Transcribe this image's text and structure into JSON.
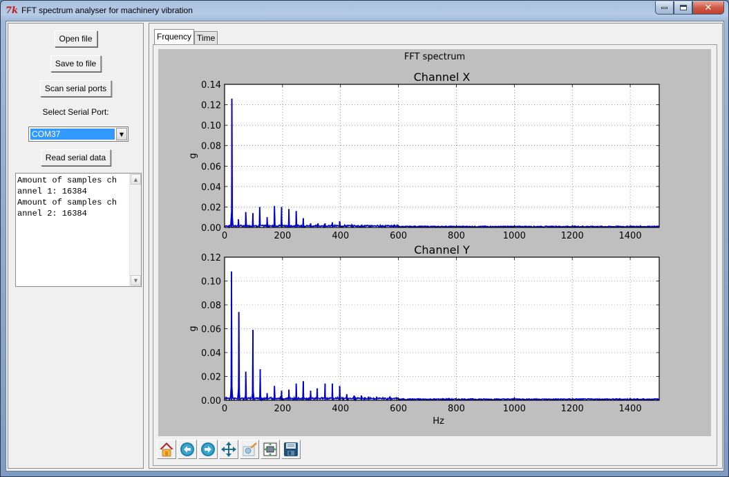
{
  "window": {
    "title": "FFT spectrum analyser for machinery vibration",
    "app_icon": "tk-feather-icon",
    "controls": {
      "minimize": "minimize",
      "maximize": "maximize",
      "close": "close"
    }
  },
  "left_panel": {
    "open_file": "Open file",
    "save_to_file": "Save to file",
    "scan_serial_ports": "Scan serial ports",
    "select_port_label": "Select Serial Port:",
    "serial_port_value": "COM37",
    "read_serial_data": "Read serial data",
    "log_text": "Amount of samples ch\nannel 1: 16384\nAmount of samples ch\nannel 2: 16384"
  },
  "tabs": [
    {
      "label": "Frquency",
      "active": true
    },
    {
      "label": "Time",
      "active": false
    }
  ],
  "toolbar": {
    "items": [
      {
        "name": "home",
        "icon": "home-icon"
      },
      {
        "name": "back",
        "icon": "back-arrow-icon"
      },
      {
        "name": "forward",
        "icon": "forward-arrow-icon"
      },
      {
        "name": "pan",
        "icon": "pan-move-icon"
      },
      {
        "name": "zoom",
        "icon": "zoom-rect-icon"
      },
      {
        "name": "subplots",
        "icon": "configure-subplots-icon"
      },
      {
        "name": "save",
        "icon": "save-floppy-icon"
      }
    ]
  },
  "chart_data": {
    "suptitle": "FFT spectrum",
    "colors": {
      "line": "#0000cc",
      "figure_bg": "#bfbfbf",
      "axes_bg": "#ffffff"
    },
    "charts": [
      {
        "type": "line",
        "title": "Channel X",
        "xlabel": "",
        "ylabel": "g",
        "xlim": [
          0,
          1500
        ],
        "ylim": [
          0,
          0.14
        ],
        "xticks": [
          0,
          200,
          400,
          600,
          800,
          1000,
          1200,
          1400
        ],
        "yticks": [
          "0.00",
          "0.02",
          "0.04",
          "0.06",
          "0.08",
          "0.10",
          "0.12",
          "0.14"
        ],
        "grid": true,
        "baseline": 0.001,
        "peaks": [
          {
            "x": 25,
            "y": 0.126
          },
          {
            "x": 48,
            "y": 0.008
          },
          {
            "x": 73,
            "y": 0.015
          },
          {
            "x": 98,
            "y": 0.014
          },
          {
            "x": 121,
            "y": 0.02
          },
          {
            "x": 147,
            "y": 0.01
          },
          {
            "x": 172,
            "y": 0.021
          },
          {
            "x": 197,
            "y": 0.02
          },
          {
            "x": 222,
            "y": 0.018
          },
          {
            "x": 247,
            "y": 0.016
          },
          {
            "x": 272,
            "y": 0.009
          },
          {
            "x": 297,
            "y": 0.004
          },
          {
            "x": 322,
            "y": 0.004
          },
          {
            "x": 347,
            "y": 0.004
          },
          {
            "x": 372,
            "y": 0.005
          },
          {
            "x": 397,
            "y": 0.006
          },
          {
            "x": 470,
            "y": 0.001
          },
          {
            "x": 1000,
            "y": 0.001
          }
        ]
      },
      {
        "type": "line",
        "title": "Channel Y",
        "xlabel": "Hz",
        "ylabel": "g",
        "xlim": [
          0,
          1500
        ],
        "ylim": [
          0,
          0.12
        ],
        "xticks": [
          0,
          200,
          400,
          600,
          800,
          1000,
          1200,
          1400
        ],
        "yticks": [
          "0.00",
          "0.02",
          "0.04",
          "0.06",
          "0.08",
          "0.10",
          "0.12"
        ],
        "grid": true,
        "baseline": 0.001,
        "peaks": [
          {
            "x": 24,
            "y": 0.108
          },
          {
            "x": 49,
            "y": 0.074
          },
          {
            "x": 73,
            "y": 0.024
          },
          {
            "x": 98,
            "y": 0.059
          },
          {
            "x": 123,
            "y": 0.026
          },
          {
            "x": 147,
            "y": 0.006
          },
          {
            "x": 172,
            "y": 0.012
          },
          {
            "x": 197,
            "y": 0.008
          },
          {
            "x": 222,
            "y": 0.009
          },
          {
            "x": 247,
            "y": 0.014
          },
          {
            "x": 272,
            "y": 0.016
          },
          {
            "x": 297,
            "y": 0.008
          },
          {
            "x": 320,
            "y": 0.01
          },
          {
            "x": 347,
            "y": 0.014
          },
          {
            "x": 372,
            "y": 0.014
          },
          {
            "x": 397,
            "y": 0.012
          },
          {
            "x": 422,
            "y": 0.005
          },
          {
            "x": 447,
            "y": 0.004
          },
          {
            "x": 472,
            "y": 0.004
          },
          {
            "x": 497,
            "y": 0.003
          },
          {
            "x": 525,
            "y": 0.003
          },
          {
            "x": 1000,
            "y": 0.002
          },
          {
            "x": 1070,
            "y": 0.001
          }
        ]
      }
    ]
  }
}
